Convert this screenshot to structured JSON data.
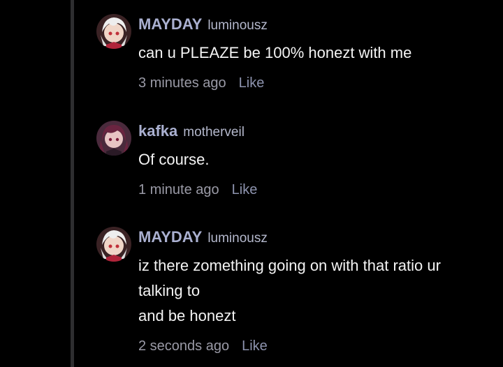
{
  "comments": [
    {
      "display_name": "MAYDAY",
      "username": "luminousz",
      "avatar_icon": "anime-avatar-white-hair-icon",
      "lines": [
        "can u PLEAZE be 100% honezt with me"
      ],
      "time": "3 minutes ago",
      "like_label": "Like"
    },
    {
      "display_name": "kafka",
      "username": "motherveil",
      "avatar_icon": "anime-avatar-dark-hair-icon",
      "lines": [
        "Of course."
      ],
      "time": "1 minute ago",
      "like_label": "Like"
    },
    {
      "display_name": "MAYDAY",
      "username": "luminousz",
      "avatar_icon": "anime-avatar-white-hair-icon",
      "lines": [
        "iz there zomething going on with that ratio ur",
        "talking to",
        "and be honezt"
      ],
      "time": "2 seconds ago",
      "like_label": "Like"
    }
  ],
  "colors": {
    "background": "#000000",
    "thread_line": "#2e2e30",
    "display_name": "#aab0d0",
    "username": "#b4b8cc",
    "text": "#f4f4f4",
    "time": "#9a9aa6",
    "like": "#8d93ae"
  }
}
